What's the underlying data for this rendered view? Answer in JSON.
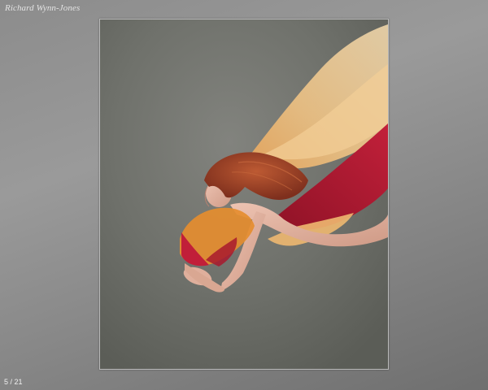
{
  "gallery": {
    "title": "Richard Wynn-Jones",
    "counter": "5 / 21"
  },
  "photo": {
    "subject": "dancer-with-flowing-fabric",
    "colors": {
      "background": "#6f716b",
      "fabric_gold": "#f1c488",
      "fabric_red": "#a8192e",
      "fabric_orange": "#e28a2a",
      "hair": "#a5452a",
      "skin": "#e2b3a1"
    }
  }
}
